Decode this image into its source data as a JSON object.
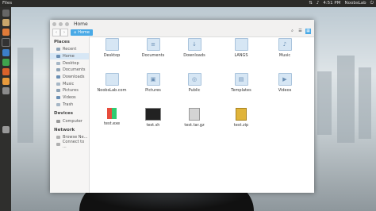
{
  "topbar": {
    "app_title": "Files",
    "time": "4:51 PM",
    "user": "NoobsLab"
  },
  "window": {
    "location": "Home",
    "sidebar": {
      "places_header": "Places",
      "places": [
        "Recent",
        "Home",
        "Desktop",
        "Documents",
        "Downloads",
        "Music",
        "Pictures",
        "Videos",
        "Trash"
      ],
      "devices_header": "Devices",
      "devices": [
        "Computer"
      ],
      "network_header": "Network",
      "network": [
        "Browse Ne...",
        "Connect to ..."
      ]
    },
    "files": [
      {
        "name": "Desktop",
        "kind": "folder"
      },
      {
        "name": "Documents",
        "kind": "folder"
      },
      {
        "name": "Downloads",
        "kind": "folder"
      },
      {
        "name": "LANGS",
        "kind": "folder"
      },
      {
        "name": "Music",
        "kind": "folder"
      },
      {
        "name": "NoobsLab.com",
        "kind": "folder"
      },
      {
        "name": "Pictures",
        "kind": "folder"
      },
      {
        "name": "Public",
        "kind": "folder"
      },
      {
        "name": "Templates",
        "kind": "folder"
      },
      {
        "name": "Videos",
        "kind": "folder"
      },
      {
        "name": "test.exe",
        "kind": "exe"
      },
      {
        "name": "test.sh",
        "kind": "script"
      },
      {
        "name": "test.tar.gz",
        "kind": "archive"
      },
      {
        "name": "test.zip",
        "kind": "zip"
      }
    ]
  }
}
